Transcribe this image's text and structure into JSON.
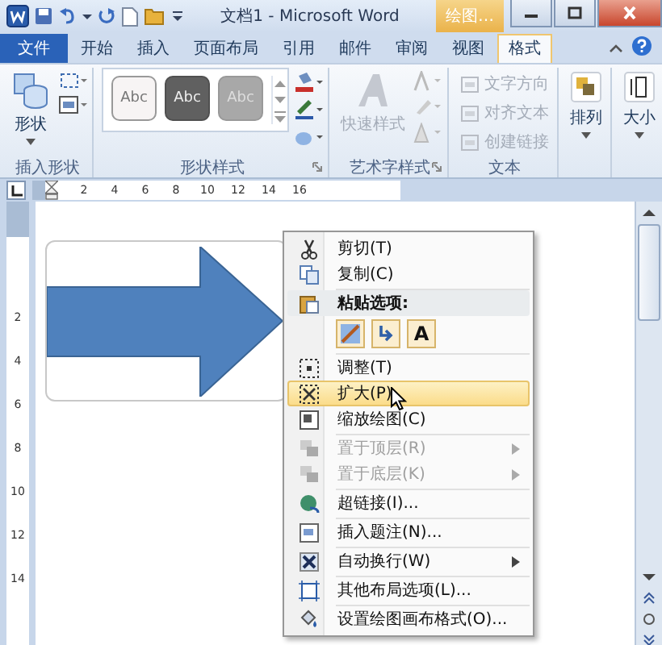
{
  "title_bar": {
    "title": "文档1 - Microsoft Word",
    "contextual_tab": "绘图…"
  },
  "tabs": [
    {
      "label": "文件",
      "kind": "file",
      "selected": false
    },
    {
      "label": "开始",
      "kind": "tab",
      "selected": false
    },
    {
      "label": "插入",
      "kind": "tab",
      "selected": false
    },
    {
      "label": "页面布局",
      "kind": "tab",
      "selected": false
    },
    {
      "label": "引用",
      "kind": "tab",
      "selected": false
    },
    {
      "label": "邮件",
      "kind": "tab",
      "selected": false
    },
    {
      "label": "审阅",
      "kind": "tab",
      "selected": false
    },
    {
      "label": "视图",
      "kind": "tab",
      "selected": false
    },
    {
      "label": "格式",
      "kind": "tab",
      "selected": true
    }
  ],
  "ribbon": {
    "groups": [
      {
        "kind": "insert_shapes",
        "label": "插入形状",
        "button": "形状"
      },
      {
        "kind": "shape_styles",
        "label": "形状样式",
        "swatches": [
          {
            "label": "Abc",
            "kind": "light"
          },
          {
            "label": "Abc",
            "kind": "dark"
          },
          {
            "label": "Abc",
            "kind": "medium"
          }
        ]
      },
      {
        "kind": "wordart",
        "label": "艺术字样式",
        "button": "快速样式"
      },
      {
        "kind": "text",
        "label": "文本",
        "commands": [
          {
            "label": "文字方向",
            "disabled": true
          },
          {
            "label": "对齐文本",
            "disabled": true
          },
          {
            "label": "创建链接",
            "disabled": true
          }
        ]
      },
      {
        "kind": "arrange",
        "button": "排列"
      },
      {
        "kind": "size",
        "button": "大小"
      }
    ]
  },
  "ruler": {
    "horizontal": [
      "2",
      "4",
      "6",
      "8",
      "10",
      "12",
      "14",
      "16"
    ],
    "vertical": [
      "2",
      "4",
      "6",
      "8",
      "10",
      "12",
      "14"
    ]
  },
  "context_menu": {
    "items": [
      {
        "kind": "item",
        "label": "剪切(T)",
        "disabled": false,
        "submenu": false,
        "selected": false
      },
      {
        "kind": "item",
        "label": "复制(C)",
        "disabled": false,
        "submenu": false,
        "selected": false
      },
      {
        "kind": "header",
        "label": "粘贴选项:"
      },
      {
        "kind": "paste_options",
        "buttons": [
          {
            "kind": "picture"
          },
          {
            "kind": "merge"
          },
          {
            "kind": "text",
            "label": "A"
          }
        ]
      },
      {
        "kind": "item",
        "label": "调整(T)",
        "disabled": false,
        "submenu": false,
        "selected": false
      },
      {
        "kind": "item",
        "label": "扩大(P)",
        "disabled": false,
        "submenu": false,
        "selected": true
      },
      {
        "kind": "item",
        "label": "缩放绘图(C)",
        "disabled": false,
        "submenu": false,
        "selected": false
      },
      {
        "kind": "item",
        "label": "置于顶层(R)",
        "disabled": true,
        "submenu": true,
        "selected": false
      },
      {
        "kind": "item",
        "label": "置于底层(K)",
        "disabled": true,
        "submenu": true,
        "selected": false
      },
      {
        "kind": "item",
        "label": "超链接(I)...",
        "disabled": false,
        "submenu": false,
        "selected": false
      },
      {
        "kind": "item",
        "label": "插入题注(N)...",
        "disabled": false,
        "submenu": false,
        "selected": false
      },
      {
        "kind": "item",
        "label": "自动换行(W)",
        "disabled": false,
        "submenu": true,
        "selected": false
      },
      {
        "kind": "item",
        "label": "其他布局选项(L)...",
        "disabled": false,
        "submenu": false,
        "selected": false
      },
      {
        "kind": "item",
        "label": "设置绘图画布格式(O)...",
        "disabled": false,
        "submenu": false,
        "selected": false
      }
    ]
  }
}
